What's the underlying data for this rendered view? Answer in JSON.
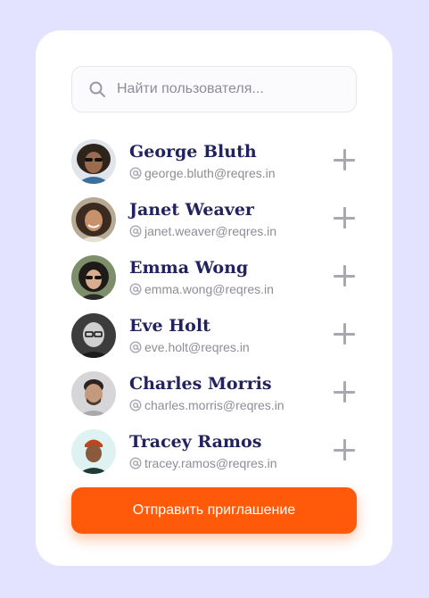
{
  "search": {
    "placeholder": "Найти пользователя..."
  },
  "users": [
    {
      "name": "George Bluth",
      "email": "george.bluth@reqres.in"
    },
    {
      "name": "Janet Weaver",
      "email": "janet.weaver@reqres.in"
    },
    {
      "name": "Emma Wong",
      "email": "emma.wong@reqres.in"
    },
    {
      "name": "Eve Holt",
      "email": "eve.holt@reqres.in"
    },
    {
      "name": "Charles Morris",
      "email": "charles.morris@reqres.in"
    },
    {
      "name": "Tracey Ramos",
      "email": "tracey.ramos@reqres.in"
    }
  ],
  "invite": {
    "label": "Отправить приглашение"
  },
  "colors": {
    "background": "#e4e3ff",
    "accent": "#ff5a0a",
    "name_text": "#22225e",
    "muted_text": "#8d8d96"
  },
  "icons": {
    "search": "search-icon",
    "email": "at-icon",
    "add": "plus-icon"
  }
}
